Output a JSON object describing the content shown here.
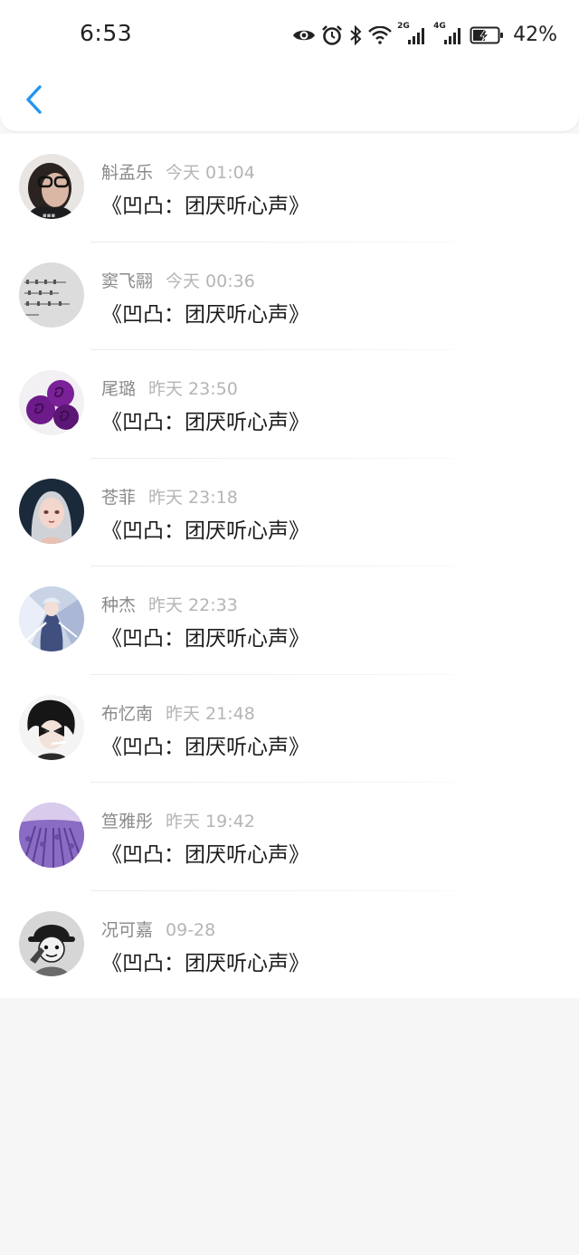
{
  "status_bar": {
    "time": "6:53",
    "battery_percent": "42%",
    "network_2g": "2G",
    "network_4g": "4G"
  },
  "colors": {
    "accent": "#2196f3",
    "name_text": "#8a8a8a",
    "time_text": "#b5b5b5",
    "title_text": "#1c1c1c"
  },
  "nav": {
    "back_icon": "chevron-left-icon"
  },
  "items": [
    {
      "name": "斛孟乐",
      "time": "今天 01:04",
      "title": "《凹凸：团厌听心声》"
    },
    {
      "name": "窦飞翮",
      "time": "今天 00:36",
      "title": "《凹凸：团厌听心声》"
    },
    {
      "name": "尾璐",
      "time": "昨天 23:50",
      "title": "《凹凸：团厌听心声》"
    },
    {
      "name": "苍菲",
      "time": "昨天 23:18",
      "title": "《凹凸：团厌听心声》"
    },
    {
      "name": "种杰",
      "time": "昨天 22:33",
      "title": "《凹凸：团厌听心声》"
    },
    {
      "name": "布忆南",
      "time": "昨天 21:48",
      "title": "《凹凸：团厌听心声》"
    },
    {
      "name": "笪雅彤",
      "time": "昨天 19:42",
      "title": "《凹凸：团厌听心声》"
    },
    {
      "name": "况可嘉",
      "time": "09-28",
      "title": "《凹凸：团厌听心声》"
    }
  ]
}
